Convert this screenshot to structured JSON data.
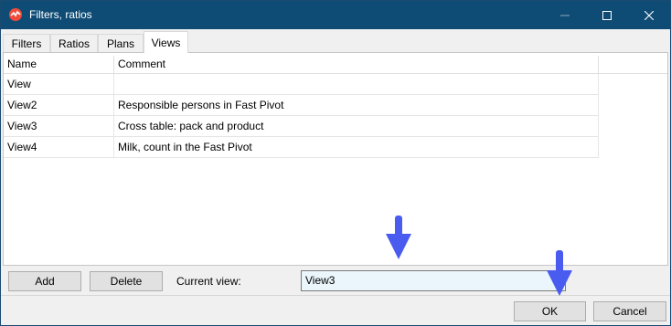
{
  "window": {
    "title": "Filters, ratios"
  },
  "tabs": [
    {
      "label": "Filters"
    },
    {
      "label": "Ratios"
    },
    {
      "label": "Plans"
    },
    {
      "label": "Views"
    }
  ],
  "active_tab": "Views",
  "table": {
    "columns": [
      "Name",
      "Comment"
    ],
    "rows": [
      {
        "name": "View",
        "comment": ""
      },
      {
        "name": "View2",
        "comment": "Responsible persons in Fast Pivot"
      },
      {
        "name": "View3",
        "comment": "Cross table: pack and product"
      },
      {
        "name": "View4",
        "comment": "Milk, count in the Fast Pivot"
      }
    ]
  },
  "controls": {
    "add_label": "Add",
    "delete_label": "Delete",
    "current_view_label": "Current view:",
    "current_view_value": "View3",
    "ok_label": "OK",
    "cancel_label": "Cancel"
  },
  "colors": {
    "titlebar": "#0f4c75",
    "annotation_arrow": "#4a5cf0"
  }
}
